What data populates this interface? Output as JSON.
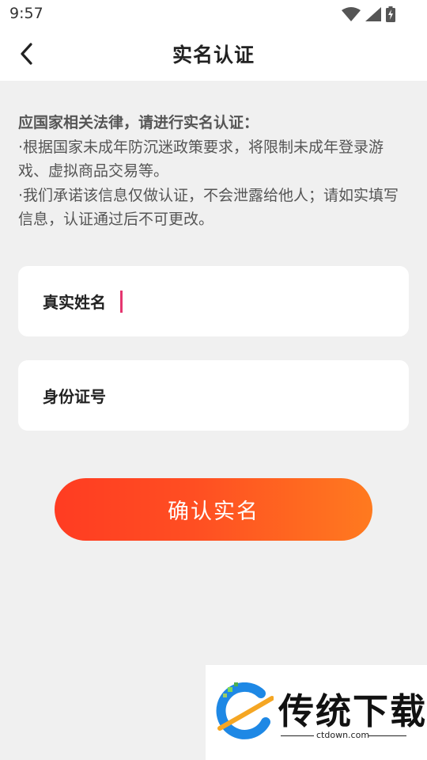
{
  "status_bar": {
    "time": "9:57",
    "icons": [
      "wifi-icon",
      "signal-icon",
      "battery-charging-icon"
    ]
  },
  "header": {
    "title": "实名认证",
    "back_icon": "chevron-left-icon"
  },
  "notice": {
    "heading": "应国家相关法律，请进行实名认证：",
    "line1": "·根据国家未成年防沉迷政策要求，将限制未成年登录游戏、虚拟商品交易等。",
    "line2": "·我们承诺该信息仅做认证，不会泄露给他人；请如实填写信息，认证通过后不可更改。"
  },
  "form": {
    "name_label": "真实姓名",
    "name_value": "",
    "id_label": "身份证号",
    "id_value": ""
  },
  "confirm_button": "确认实名",
  "watermark": {
    "brand": "传统下载",
    "domain": "ctdown.com"
  },
  "colors": {
    "accent_start": "#ff3c22",
    "accent_end": "#ff7a1f",
    "caret": "#e5366f",
    "background": "#f0f0f0"
  }
}
